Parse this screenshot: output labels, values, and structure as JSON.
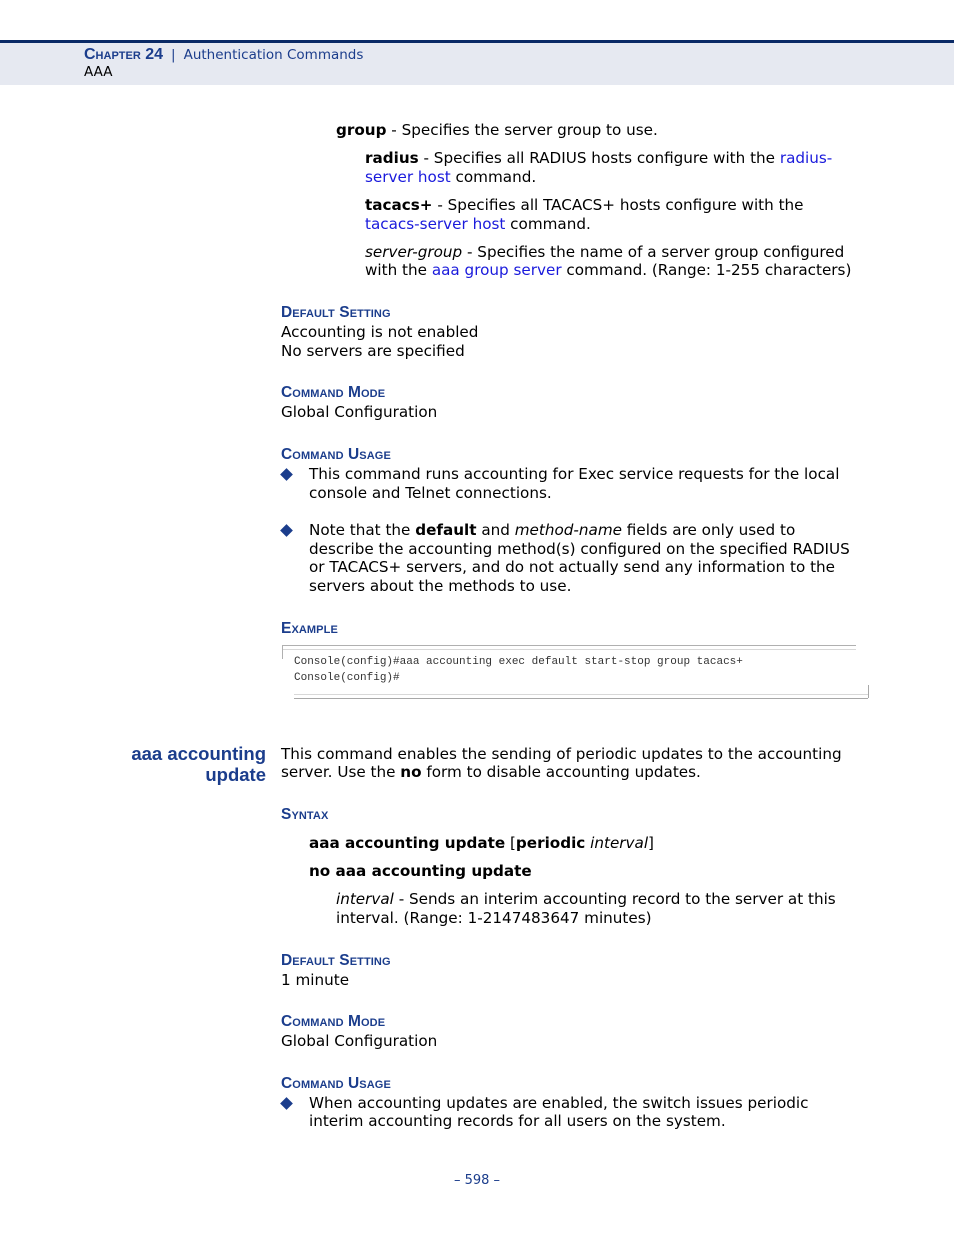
{
  "header": {
    "chapter": "Chapter 24",
    "separator": "|",
    "chapter_title": "Authentication Commands",
    "section": "AAA"
  },
  "params": {
    "group": {
      "term": "group",
      "desc": " - Specifies the server group to use."
    },
    "radius": {
      "term": "radius",
      "desc1": " - Specifies all RADIUS hosts configure with the ",
      "link_a": "radius-",
      "link_b": "server host",
      "desc2": " command."
    },
    "tacacs": {
      "term": "tacacs+",
      "desc1": " - Specifies all TACACS+ hosts configure with the",
      "link": "tacacs-server host",
      "desc2": " command."
    },
    "server_group": {
      "term": "server-group",
      "desc1": " - Specifies the name of a server group configured",
      "pre": "with the ",
      "link": "aaa group server",
      "desc2": " command. (Range: 1-255 characters)"
    }
  },
  "section1": {
    "default_setting": {
      "heading": "Default Setting",
      "lines": [
        "Accounting is not enabled",
        "No servers are specified"
      ]
    },
    "command_mode": {
      "heading": "Command Mode",
      "value": "Global Configuration"
    },
    "command_usage": {
      "heading": "Command Usage",
      "bullet1": [
        "This command runs accounting for Exec service requests for the local",
        "console and Telnet connections."
      ],
      "bullet2": {
        "pre": "Note that the ",
        "bold": "default",
        "mid": " and ",
        "italic": "method-name",
        "post": " fields are only used to",
        "lines": [
          "describe the accounting method(s) configured on the specified RADIUS",
          "or TACACS+ servers, and do not actually send any information to the",
          "servers about the methods to use."
        ]
      }
    },
    "example": {
      "heading": "Example",
      "code": [
        "Console(config)#aaa accounting exec default start-stop group tacacs+",
        "Console(config)#"
      ]
    }
  },
  "command2": {
    "name_line1": "aaa accounting",
    "name_line2": "update",
    "desc_line1": "This command enables the sending of periodic updates to the accounting",
    "desc_pre": "server. Use the ",
    "desc_bold": "no",
    "desc_post": " form to disable accounting updates.",
    "syntax": {
      "heading": "Syntax",
      "line1_bold": "aaa accounting update",
      "line1_open": " [",
      "line1_bold2": "periodic",
      "line1_italic": " interval",
      "line1_close": "]",
      "line2": "no aaa accounting update",
      "param_term": "interval",
      "param_desc": " - Sends an interim accounting record to the server at this",
      "param_desc2": "interval. (Range: 1-2147483647 minutes)"
    },
    "default_setting": {
      "heading": "Default Setting",
      "value": "1 minute"
    },
    "command_mode": {
      "heading": "Command Mode",
      "value": "Global Configuration"
    },
    "command_usage": {
      "heading": "Command Usage",
      "bullet1": [
        "When accounting updates are enabled, the switch issues periodic",
        "interim accounting records for all users on the system."
      ]
    }
  },
  "footer": {
    "page": "–  598  –"
  }
}
